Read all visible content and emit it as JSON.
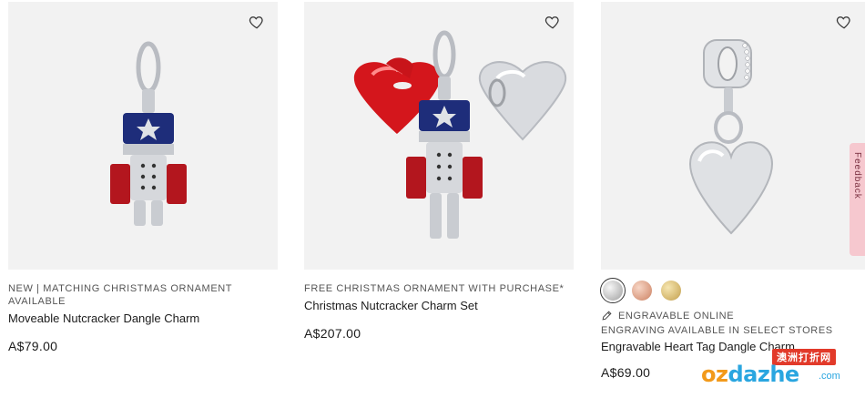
{
  "products": [
    {
      "tag": "NEW | MATCHING CHRISTMAS ORNAMENT AVAILABLE",
      "name": "Moveable Nutcracker Dangle Charm",
      "price": "A$79.00"
    },
    {
      "tag": "FREE CHRISTMAS ORNAMENT WITH PURCHASE*",
      "name": "Christmas Nutcracker Charm Set",
      "price": "A$207.00"
    },
    {
      "engrave_label": "ENGRAVABLE ONLINE",
      "tag": "ENGRAVING AVAILABLE IN SELECT STORES",
      "name": "Engravable Heart Tag Dangle Charm",
      "price": "A$69.00",
      "swatches": [
        "silver",
        "rose-gold",
        "gold"
      ],
      "selected_swatch": "silver"
    }
  ],
  "feedback_tab": {
    "label": "Feedback"
  },
  "watermark": {
    "banner": "澳洲打折网",
    "logo_prefix": "oz",
    "logo_rest": "dazhe",
    "logo_suffix": ".com"
  }
}
